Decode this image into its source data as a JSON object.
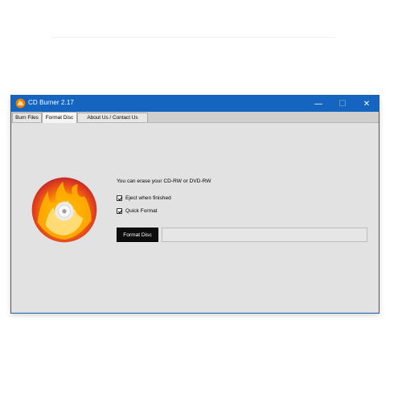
{
  "window": {
    "title": "CD Burner 2.17",
    "controls": {
      "minimize": "—",
      "maximize": "☐",
      "close": "✕"
    }
  },
  "tabs": [
    {
      "label": "Burn Files",
      "selected": false
    },
    {
      "label": "Format Disc",
      "selected": true
    },
    {
      "label": "About Us / Contact Us",
      "selected": false
    }
  ],
  "format_panel": {
    "info_text": "You can erase your CD-RW or DVD-RW",
    "eject_label": "Eject when finished",
    "eject_checked": true,
    "quick_label": "Quick Format",
    "quick_checked": true,
    "format_button_label": "Format Disc",
    "progress_fraction": 0
  },
  "icons": {
    "app": "flaming-disc-icon",
    "logo": "flaming-disc-logo"
  },
  "colors": {
    "titlebar": "#1565c0",
    "window_bg": "#e2e2e2",
    "button_bg": "#0d0d0d",
    "progress_fill": "#06b025"
  }
}
